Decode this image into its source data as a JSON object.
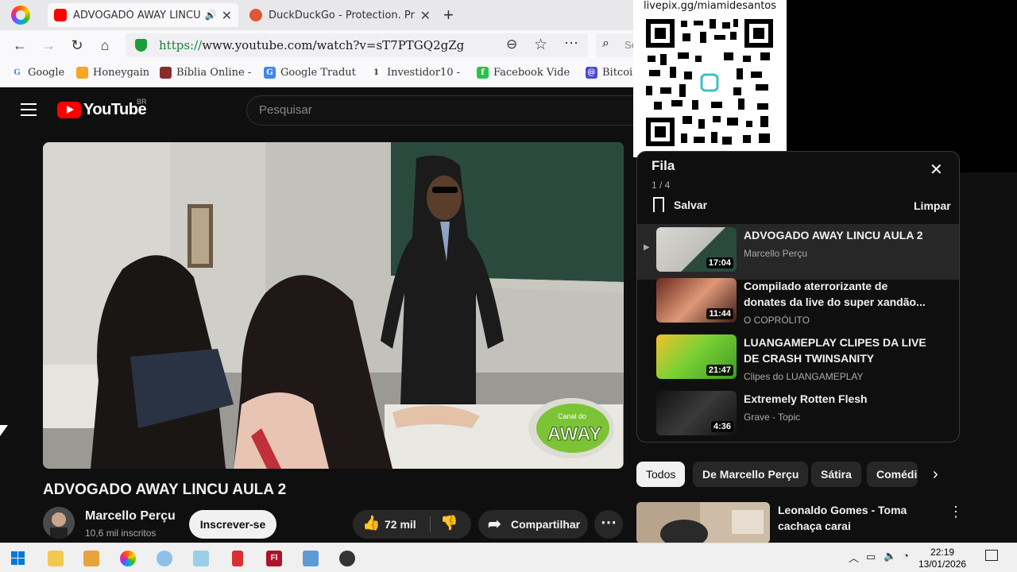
{
  "browser": {
    "tabs": [
      {
        "title": "ADVOGADO AWAY LINCU AULA 2",
        "active": true
      },
      {
        "title": "DuckDuckGo - Protection. Pri",
        "active": false
      }
    ],
    "url_scheme": "https://",
    "url_rest": "www.youtube.com/watch?v=sT7PTGQ2gZg",
    "search_partial": "Se",
    "bookmarks": [
      "Google",
      "Honeygain",
      "Bíblia Online -",
      "Google Tradut",
      "Investidor10 -",
      "Facebook Vide",
      "Bitcoi"
    ]
  },
  "youtube": {
    "logo_text": "YouTube",
    "country_code": "BR",
    "search_placeholder": "Pesquisar",
    "video": {
      "title": "ADVOGADO AWAY LINCU AULA 2",
      "channel": "Marcello Perçu",
      "subscribers": "10,6 mil inscritos",
      "subscribe_label": "Inscrever-se",
      "likes": "72 mil",
      "share_label": "Compartilhar",
      "watermark_small": "Canal do",
      "watermark_big": "AWAY"
    },
    "overlay": {
      "qr_label": "livepix.gg/miamidesantos"
    },
    "queue": {
      "title": "Fila",
      "count": "1 / 4",
      "save_label": "Salvar",
      "clear_label": "Limpar",
      "items": [
        {
          "title": "ADVOGADO AWAY LINCU AULA 2",
          "channel": "Marcello Perçu",
          "duration": "17:04"
        },
        {
          "title": "Compilado aterrorizante de donates da live do super xandão...",
          "channel": "O COPRÓLITO",
          "duration": "11:44"
        },
        {
          "title": "LUANGAMEPLAY CLIPES DA LIVE DE CRASH TWINSANITY",
          "channel": "Clipes do LUANGAMEPLAY",
          "duration": "21:47"
        },
        {
          "title": "Extremely Rotten Flesh",
          "channel": "Grave - Topic",
          "duration": "4:36"
        }
      ]
    },
    "chips": [
      "Todos",
      "De Marcello Perçu",
      "Sátira",
      "Comédi"
    ],
    "recommendation": {
      "title": "Leonaldo Gomes - Toma cachaça carai"
    }
  },
  "taskbar": {
    "time": "22:19",
    "date": "13/01/2026"
  }
}
